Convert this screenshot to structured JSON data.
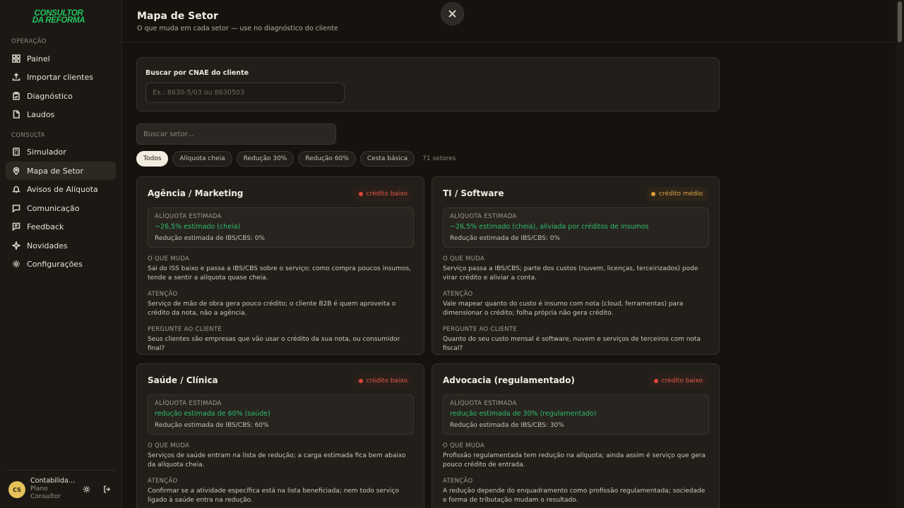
{
  "sidebar": {
    "logo_line1": "CONSULTOR",
    "logo_line2": "DA REFORMA",
    "section_operacao": "OPERAÇÃO",
    "section_consulta": "CONSULTA",
    "items": [
      {
        "label": "Painel",
        "icon": "grid-icon"
      },
      {
        "label": "Importar clientes",
        "icon": "upload-icon"
      },
      {
        "label": "Diagnóstico",
        "icon": "clipboard-check-icon"
      },
      {
        "label": "Laudos",
        "icon": "file-icon"
      },
      {
        "label": "Simulador",
        "icon": "calculator-icon"
      },
      {
        "label": "Mapa de Setor",
        "icon": "map-pin-icon"
      },
      {
        "label": "Avisos de Alíquota",
        "icon": "bell-icon"
      },
      {
        "label": "Comunicação",
        "icon": "message-icon"
      },
      {
        "label": "Feedback",
        "icon": "feedback-icon"
      },
      {
        "label": "Novidades",
        "icon": "sparkle-icon"
      },
      {
        "label": "Configurações",
        "icon": "gear-icon"
      }
    ],
    "user": {
      "initials": "CS",
      "name": "Contabilidade Silva",
      "plan": "Plano Consultor"
    }
  },
  "header": {
    "title": "Mapa de Setor",
    "subtitle": "O que muda em cada setor — use no diagnóstico do cliente"
  },
  "cnae": {
    "label": "Buscar por CNAE do cliente",
    "placeholder": "Ex.: 8630-5/03 ou 8630503"
  },
  "search": {
    "placeholder": "Buscar setor..."
  },
  "filters": {
    "chips": [
      "Todos",
      "Alíquota cheia",
      "Redução 30%",
      "Redução 60%",
      "Cesta básica"
    ],
    "count": "71 setores"
  },
  "labels": {
    "rate": "ALÍQUOTA ESTIMADA",
    "changes": "O QUE MUDA",
    "attention": "ATENÇÃO",
    "ask": "PERGUNTE AO CLIENTE"
  },
  "cards": [
    {
      "title": "Agência / Marketing",
      "badge": "crédito baixo",
      "rate": "~26,5% estimado (cheia)",
      "reduction": "Redução estimada de IBS/CBS: 0%",
      "changes": "Sai do ISS baixo e passa a IBS/CBS sobre o serviço; como compra poucos insumos, tende a sentir a alíquota quase cheia.",
      "attention": "Serviço de mão de obra gera pouco crédito; o cliente B2B é quem aproveita o crédito da nota, não a agência.",
      "ask": "Seus clientes são empresas que vão usar o crédito da sua nota, ou consumidor final?"
    },
    {
      "title": "TI / Software",
      "badge": "crédito médio",
      "rate": "~26,5% estimado (cheia), aliviada por créditos de insumos",
      "reduction": "Redução estimada de IBS/CBS: 0%",
      "changes": "Serviço passa a IBS/CBS; parte dos custos (nuvem, licenças, terceirizados) pode virar crédito e aliviar a conta.",
      "attention": "Vale mapear quanto do custo é insumo com nota (cloud, ferramentas) para dimensionar o crédito; folha própria não gera crédito.",
      "ask": "Quanto do seu custo mensal é software, nuvem e serviços de terceiros com nota fiscal?"
    },
    {
      "title": "Saúde / Clínica",
      "badge": "crédito baixo",
      "rate": "redução estimada de 60% (saúde)",
      "reduction": "Redução estimada de IBS/CBS: 60%",
      "changes": "Serviços de saúde entram na lista de redução; a carga estimada fica bem abaixo da alíquota cheia.",
      "attention": "Confirmar se a atividade específica está na lista beneficiada; nem todo serviço ligado à saúde entra na redução."
    },
    {
      "title": "Advocacia (regulamentado)",
      "badge": "crédito baixo",
      "rate": "redução estimada de 30% (regulamentado)",
      "reduction": "Redução estimada de IBS/CBS: 30%",
      "changes": "Profissão regulamentada tem redução na alíquota; ainda assim é serviço que gera pouco crédito de entrada.",
      "attention": "A redução depende do enquadramento como profissão regulamentada; sociedade e forma de tributação mudam o resultado."
    }
  ]
}
